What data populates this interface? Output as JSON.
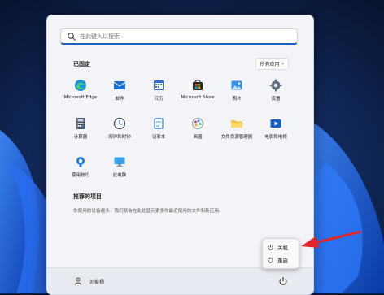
{
  "search": {
    "placeholder": "在此键入以搜索"
  },
  "pinned": {
    "title": "已固定",
    "all_apps_label": "所有应用",
    "apps": [
      {
        "name": "edge",
        "label": "Microsoft Edge"
      },
      {
        "name": "mail",
        "label": "邮件"
      },
      {
        "name": "calendar",
        "label": "日历"
      },
      {
        "name": "store",
        "label": "Microsoft Store"
      },
      {
        "name": "photos",
        "label": "照片"
      },
      {
        "name": "settings",
        "label": "设置"
      },
      {
        "name": "calculator",
        "label": "计算器"
      },
      {
        "name": "clock",
        "label": "闹钟和时钟"
      },
      {
        "name": "notepad",
        "label": "记事本"
      },
      {
        "name": "paint",
        "label": "画图"
      },
      {
        "name": "explorer",
        "label": "文件资源管理器"
      },
      {
        "name": "movies",
        "label": "电影和电视"
      },
      {
        "name": "tips",
        "label": "使用技巧"
      },
      {
        "name": "thispc",
        "label": "此电脑"
      }
    ]
  },
  "recommended": {
    "title": "推荐的项目",
    "description": "你使用的设备越多，我们就会在此处显示更多你最近使用的文件和新应用。"
  },
  "user": {
    "name": "刘俊杨"
  },
  "power_menu": {
    "shutdown_label": "关机",
    "restart_label": "重启"
  },
  "colors": {
    "accent": "#1f5fbf",
    "arrow": "#e0262b"
  }
}
